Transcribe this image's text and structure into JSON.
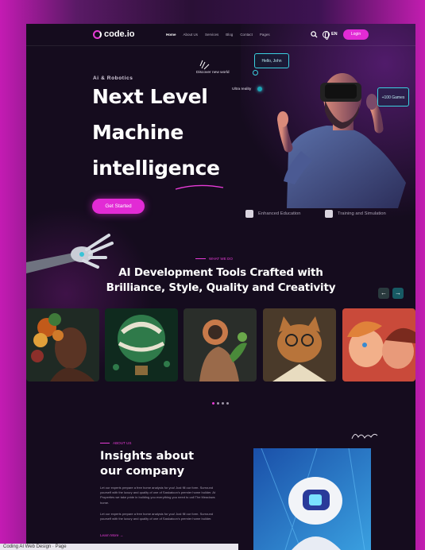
{
  "nav": {
    "logo": "code.io",
    "links": [
      "Home",
      "About Us",
      "Services",
      "Blog",
      "Contact",
      "Pages"
    ],
    "lang": "EN",
    "login": "Login"
  },
  "hero": {
    "tag": "Ai & Robotics",
    "title_line1": "Next Level",
    "title_line2": "Machine",
    "title_line3": "intelligence",
    "cta": "Get Started",
    "discover": "Discover new world",
    "ultra": "Ultra reality",
    "hello": "Hello, John",
    "games": "+100 Games",
    "feature1": "Enhanced Education",
    "feature2": "Training and Simulation"
  },
  "section2": {
    "eyebrow": "WHAT WE DO",
    "title_line1": "AI  Development Tools Crafted with",
    "title_line2": "Brilliance, Style, Quality and Creativity",
    "prev": "←",
    "next": "→"
  },
  "section3": {
    "eyebrow": "ABOUT US",
    "title_line1": "Insights about",
    "title_line2": "our company",
    "para1": "Let our experts prepare a free home analysis for you! Just fill our form. Surround yourself with the luxury and quality of one of Saskatoon's premier home builder. At Properties we take pride in building you everything you need to call The Meadows home.",
    "para2": "Let our experts prepare a free home analysis for you! Just fill our form. Surround yourself with the luxury and quality of one of Saskatoon's premier home builder.",
    "learn_more": "Learn More →"
  },
  "caption": "Coding AI Web Design · Page",
  "colors": {
    "accent": "#e22bd5",
    "cyan": "#3ad0e0",
    "bg": "#150c1e"
  }
}
